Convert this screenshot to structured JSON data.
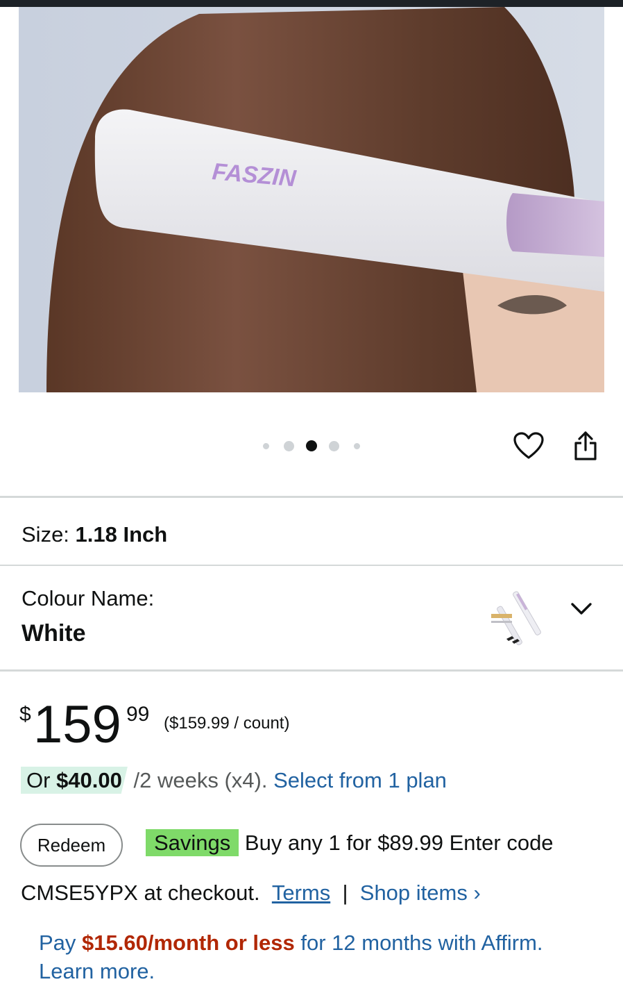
{
  "product": {
    "image": {
      "brand_text": "FASZIN",
      "dots_count": 5,
      "active_dot": 3
    },
    "size": {
      "label": "Size:",
      "value": "1.18 Inch"
    },
    "colour": {
      "label": "Colour Name:",
      "value": "White"
    },
    "price": {
      "symbol": "$",
      "whole": "159",
      "fraction": "99",
      "unit_price": "($159.99 / count)"
    },
    "installments": {
      "or_text": "Or",
      "amount": "$40.00",
      "terms": " /2 weeks (x4).",
      "link": "Select from 1 plan"
    },
    "promo": {
      "redeem_label": "Redeem",
      "badge": "Savings",
      "text": "Buy any 1 for $89.99 Enter code",
      "code_text": "CMSE5YPX at checkout.",
      "terms_link": "Terms",
      "separator": "|",
      "shop_link": "Shop items ›"
    },
    "affirm": {
      "pay": "Pay",
      "amount": "$15.60/month or less",
      "rest": "for 12 months with Affirm. Learn more."
    }
  },
  "colors": {
    "link": "#2162a1",
    "price_red": "#b12704",
    "savings_badge": "#7fda69",
    "installment_highlight": "#d8f2e6"
  }
}
